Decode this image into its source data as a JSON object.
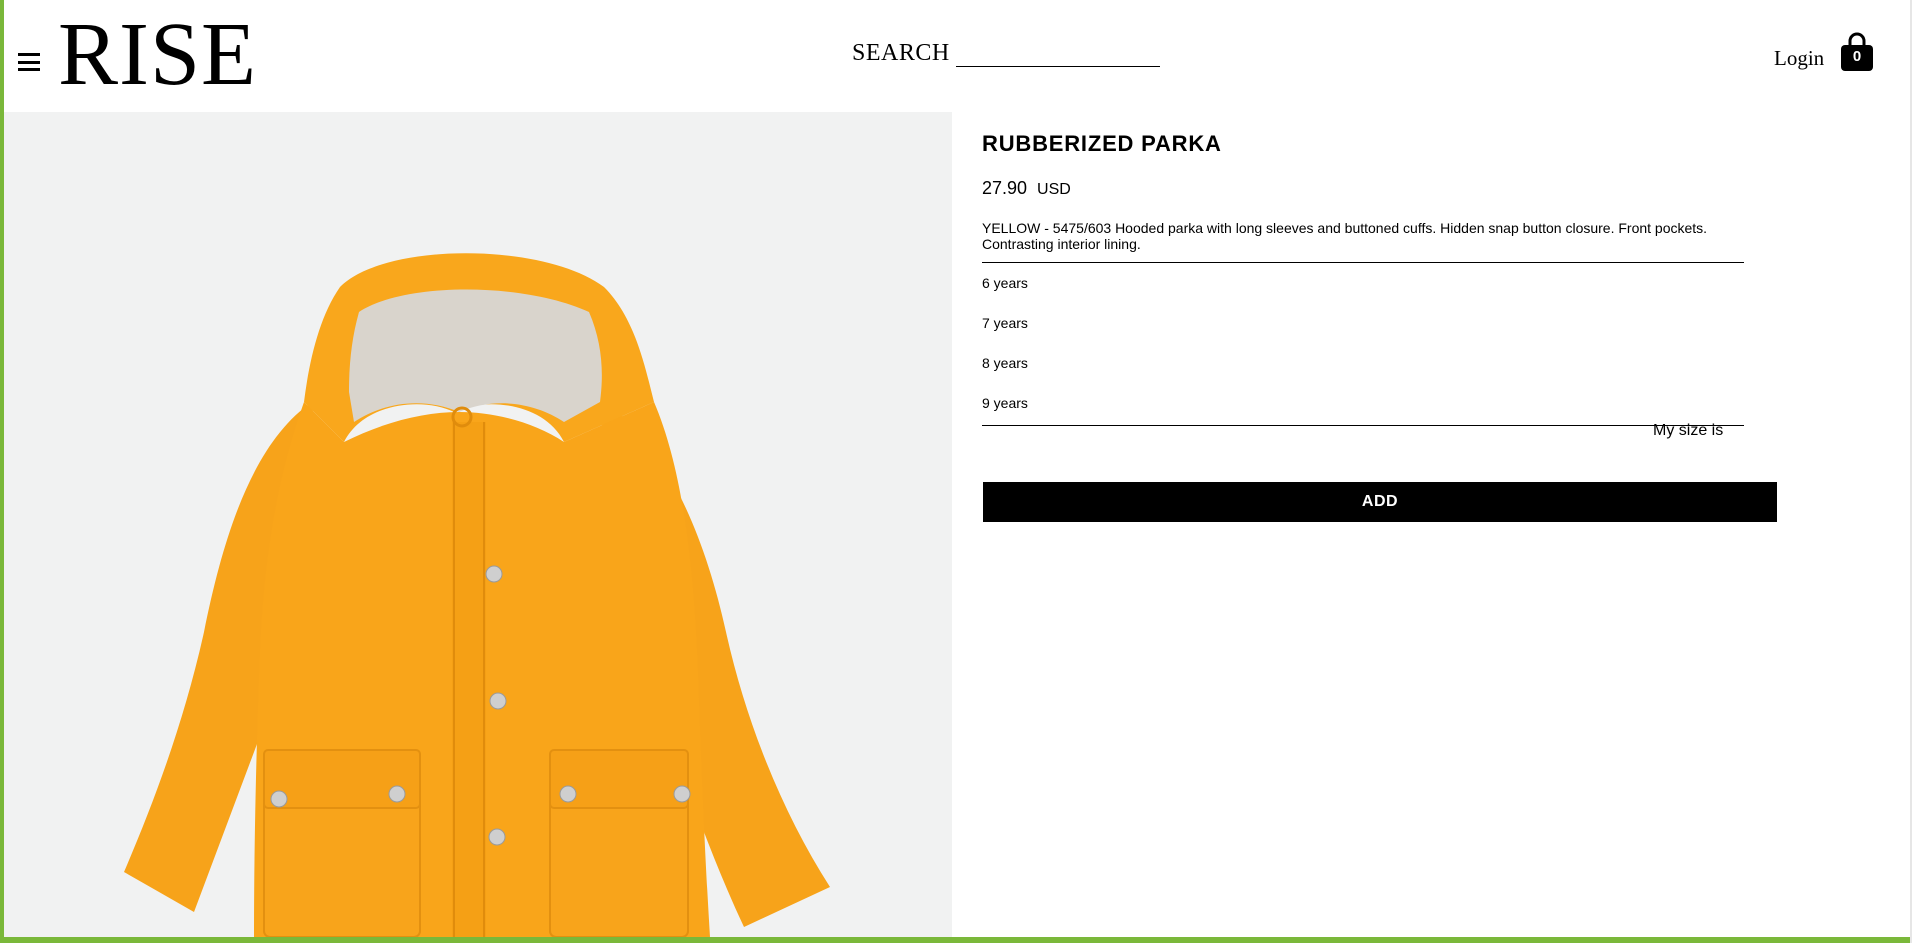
{
  "header": {
    "logo": "RISE",
    "search_label": "SEARCH",
    "search_value": "",
    "login_label": "Login",
    "cart_count": "0"
  },
  "icons": {
    "menu": "hamburger-menu-icon",
    "cart": "shopping-bag-icon"
  },
  "product": {
    "title": "RUBBERIZED PARKA",
    "price": "27.90",
    "currency": "USD",
    "description": "YELLOW - 5475/603 Hooded parka with long sleeves and buttoned cuffs. Hidden snap button closure. Front pockets. Contrasting interior lining.",
    "sizes": [
      "6 years",
      "7 years",
      "8 years",
      "9 years"
    ],
    "size_guide_label": "My size is",
    "add_label": "ADD",
    "image_colors": {
      "background": "#f1f2f2",
      "jacket": "#f9a51a",
      "jacket_shade": "#e48f0c",
      "lining": "#d9d4cc",
      "snap": "#c9c9c9"
    }
  },
  "theme": {
    "frame_accent": "#7ab83a",
    "button_bg": "#000000",
    "button_text": "#ffffff"
  }
}
